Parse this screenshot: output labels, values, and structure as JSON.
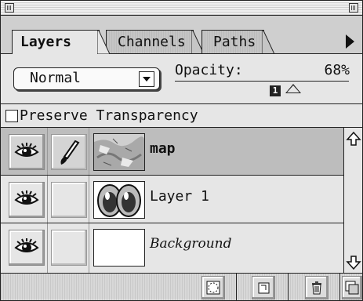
{
  "tabs": [
    {
      "label": "Layers",
      "active": true
    },
    {
      "label": "Channels",
      "active": false
    },
    {
      "label": "Paths",
      "active": false
    }
  ],
  "blend_mode": {
    "selected": "Normal"
  },
  "opacity": {
    "label": "Opacity:",
    "value": "68%",
    "fraction": 0.68,
    "badge": "1"
  },
  "preserve_transparency": {
    "label": "Preserve Transparency",
    "checked": false
  },
  "layers": [
    {
      "name": "map",
      "visible": true,
      "brush": true,
      "selected": true,
      "style": "bold"
    },
    {
      "name": "Layer 1",
      "visible": true,
      "brush": false,
      "selected": false,
      "style": "normal"
    },
    {
      "name": "Background",
      "visible": true,
      "brush": false,
      "selected": false,
      "style": "italic"
    }
  ],
  "icons": {
    "eye": "eye-icon",
    "brush": "paintbrush-icon",
    "tab_menu": "panel-menu-triangle-icon",
    "scroll_up": "scroll-up-arrow-icon",
    "scroll_down": "scroll-down-arrow-icon",
    "mask": "layer-mask-icon",
    "new_layer": "new-layer-icon",
    "delete": "trash-icon"
  },
  "colors": {
    "panel": "#e6e6e6",
    "selected": "#bdbdbd",
    "border": "#222222"
  }
}
